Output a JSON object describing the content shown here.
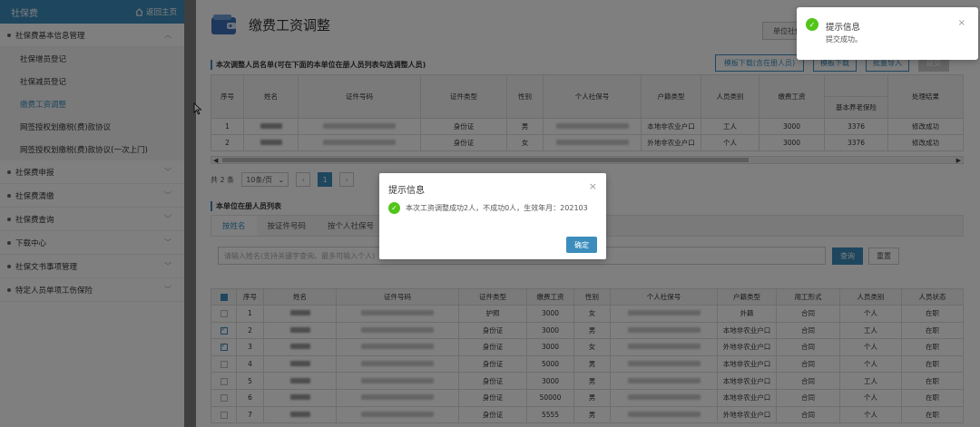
{
  "sidebar": {
    "title": "社保费",
    "home_link": "返回主页",
    "groups": [
      {
        "label": "社保费基本信息管理",
        "expanded": true,
        "items": [
          "社保增员登记",
          "社保减员登记",
          "缴费工资调整",
          "网签授权划缴税(费)款协议",
          "网签授权划缴税(费)款协议(一次上门)"
        ],
        "active_index": 2
      },
      {
        "label": "社保费申报"
      },
      {
        "label": "社保费清缴"
      },
      {
        "label": "社保费查询"
      },
      {
        "label": "下载中心"
      },
      {
        "label": "社保文书事项管理"
      },
      {
        "label": "特定人员单项工伤保险"
      }
    ]
  },
  "page": {
    "title": "缴费工资调整",
    "unit_button": "单位社保"
  },
  "adjust_section": {
    "title": "本次调整人员名单(可在下面的本单位在册人员列表勾选调整人员)",
    "buttons": [
      "模板下载(含在册人员)",
      "模板下载",
      "批量导入",
      "提交"
    ],
    "columns": [
      "序号",
      "姓名",
      "证件号码",
      "证件类型",
      "性别",
      "个人社保号",
      "户籍类型",
      "人员类别",
      "缴费工资",
      "基本养老保险",
      "处理结果"
    ],
    "rows": [
      {
        "no": "1",
        "id_type": "身份证",
        "gender": "男",
        "hukou": "本地非农业户口",
        "category": "工人",
        "wage": "3000",
        "pension": "3376",
        "result": "修改成功"
      },
      {
        "no": "2",
        "id_type": "身份证",
        "gender": "女",
        "hukou": "外地非农业户口",
        "category": "个人",
        "wage": "3000",
        "pension": "3376",
        "result": "修改成功"
      }
    ]
  },
  "pager": {
    "total": "共 2 条",
    "page_size": "10条/页",
    "current": "1"
  },
  "roster_section": {
    "title": "本单位在册人员列表",
    "tabs": [
      "按姓名",
      "按证件号码",
      "按个人社保号"
    ],
    "active_tab": 0,
    "search_placeholder": "请输入姓名(支持关键字查询、最多可输入个人)",
    "query": "查询",
    "reset": "重置",
    "columns": [
      "序号",
      "姓名",
      "证件号码",
      "证件类型",
      "缴费工资",
      "性别",
      "个人社保号",
      "户籍类型",
      "用工形式",
      "人员类别",
      "人员状态"
    ],
    "rows": [
      {
        "no": "1",
        "checked": false,
        "id_type": "护照",
        "wage": "3000",
        "gender": "女",
        "hukou": "外籍",
        "employment": "合同",
        "category": "个人",
        "status": "在职"
      },
      {
        "no": "2",
        "checked": true,
        "id_type": "身份证",
        "wage": "3000",
        "gender": "男",
        "hukou": "本地非农业户口",
        "employment": "合同",
        "category": "工人",
        "status": "在职"
      },
      {
        "no": "3",
        "checked": true,
        "id_type": "身份证",
        "wage": "3000",
        "gender": "女",
        "hukou": "外地非农业户口",
        "employment": "合同",
        "category": "个人",
        "status": "在职"
      },
      {
        "no": "4",
        "checked": false,
        "id_type": "身份证",
        "wage": "5000",
        "gender": "男",
        "hukou": "本地非农业户口",
        "employment": "合同",
        "category": "个人",
        "status": "在职"
      },
      {
        "no": "5",
        "checked": false,
        "id_type": "身份证",
        "wage": "3000",
        "gender": "男",
        "hukou": "本地非农业户口",
        "employment": "合同",
        "category": "工人",
        "status": "在职"
      },
      {
        "no": "6",
        "checked": false,
        "id_type": "身份证",
        "wage": "50000",
        "gender": "男",
        "hukou": "本地非农业户口",
        "employment": "合同",
        "category": "个人",
        "status": "在职"
      },
      {
        "no": "7",
        "checked": false,
        "id_type": "身份证",
        "wage": "5555",
        "gender": "男",
        "hukou": "外地非农业户口",
        "employment": "合同",
        "category": "个人",
        "status": "在职"
      }
    ]
  },
  "dialog": {
    "title": "提示信息",
    "message": "本次工资调整成功2人，不成功0人，生效年月：202103",
    "ok": "确定"
  },
  "toast": {
    "title": "提示信息",
    "message": "提交成功。"
  },
  "colors": {
    "primary": "#3c8dbc",
    "success": "#52c41a"
  }
}
